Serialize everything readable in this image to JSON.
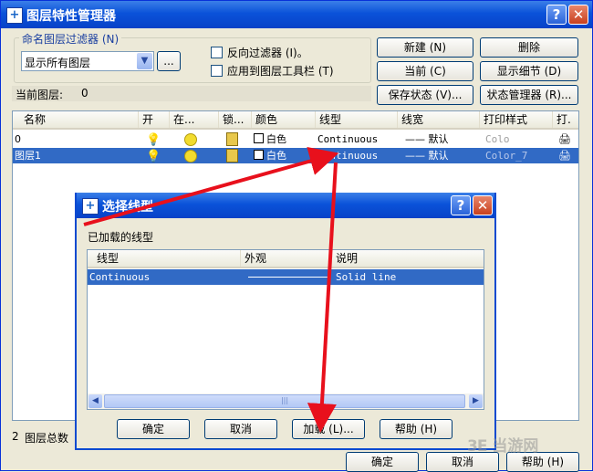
{
  "main": {
    "title": "图层特性管理器",
    "filter_group_label": "命名图层过滤器 (N)",
    "filter_value": "显示所有图层",
    "filter_more": "...",
    "invert_filter": "反向过滤器 (I)。",
    "apply_toolbar": "应用到图层工具栏 (T)",
    "current_layer_label": "当前图层:",
    "current_layer_value": "0",
    "buttons": {
      "new": "新建 (N)",
      "delete": "删除",
      "current": "当前 (C)",
      "show_details": "显示细节 (D)",
      "save_state": "保存状态 (V)...",
      "state_manager": "状态管理器 (R)..."
    },
    "columns": [
      "名称",
      "开",
      "在...",
      "锁...",
      "颜色",
      "线型",
      "线宽",
      "打印样式",
      "打."
    ],
    "layers": [
      {
        "name": "0",
        "color": "白色",
        "linetype": "Continuous",
        "lineweight": "默认",
        "plotstyle": "Colo"
      },
      {
        "name": "图层1",
        "color": "白色",
        "linetype": "Continuous",
        "lineweight": "默认",
        "plotstyle": "Color_7"
      }
    ],
    "status_count": "2",
    "status_text": "图层总数",
    "ok": "确定",
    "cancel": "取消",
    "help": "帮助 (H)"
  },
  "dialog": {
    "title": "选择线型",
    "loaded_label": "已加载的线型",
    "columns": [
      "线型",
      "外观",
      "说明"
    ],
    "rows": [
      {
        "name": "Continuous",
        "desc": "Solid line"
      }
    ],
    "ok": "确定",
    "cancel": "取消",
    "load": "加载 (L)...",
    "help": "帮助 (H)"
  },
  "watermark": "当游网",
  "colors": {
    "selection": "#316ac5",
    "titlebar": "#0a52d9",
    "arrow": "#e8101c"
  }
}
